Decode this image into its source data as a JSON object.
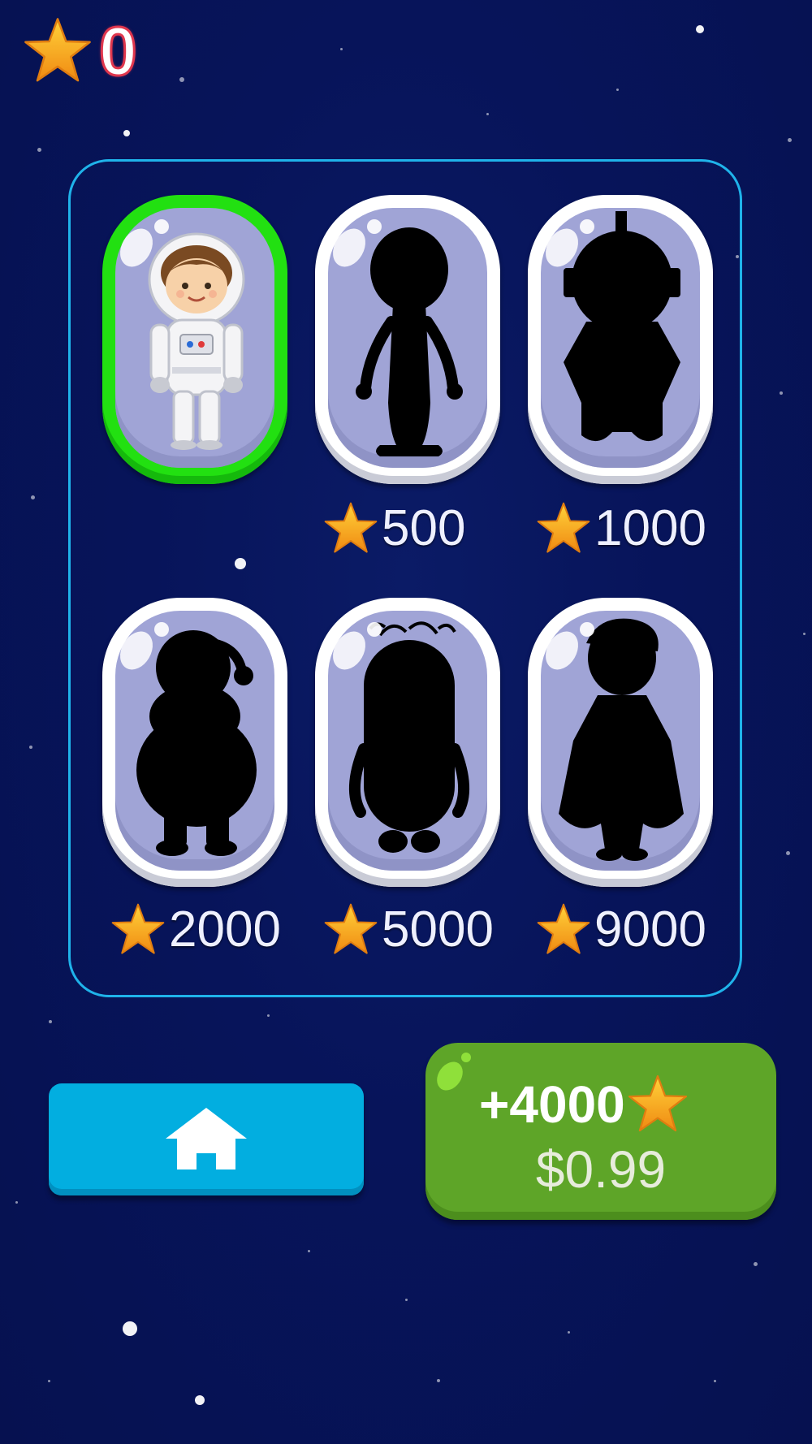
{
  "hud": {
    "star_count": "0",
    "icon": "star-icon"
  },
  "characters": [
    {
      "id": "astronaut",
      "price": "",
      "selected": true,
      "unlocked": true
    },
    {
      "id": "alien",
      "price": "500",
      "selected": false,
      "unlocked": false
    },
    {
      "id": "robot",
      "price": "1000",
      "selected": false,
      "unlocked": false
    },
    {
      "id": "santa",
      "price": "2000",
      "selected": false,
      "unlocked": false
    },
    {
      "id": "minion",
      "price": "5000",
      "selected": false,
      "unlocked": false
    },
    {
      "id": "superhero",
      "price": "9000",
      "selected": false,
      "unlocked": false
    }
  ],
  "home_button": {
    "icon": "home-icon"
  },
  "purchase": {
    "amount": "+4000",
    "price": "$0.99",
    "icon": "star-icon"
  },
  "colors": {
    "background": "#07145a",
    "panel_border": "#1fb3ea",
    "selected_border": "#22e011",
    "home_button": "#02aee0",
    "buy_button": "#5ea528",
    "star": "#f6a623"
  }
}
